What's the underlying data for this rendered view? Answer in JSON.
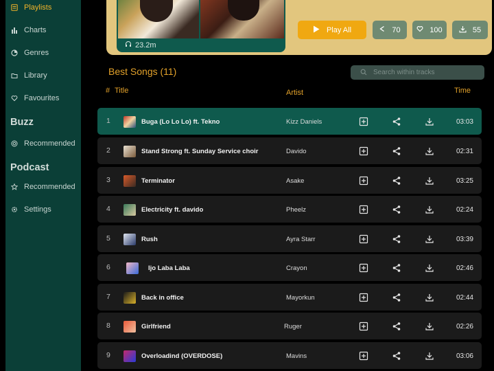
{
  "sidebar": {
    "items": [
      {
        "label": "Playlists",
        "icon": "playlist-icon",
        "active": true
      },
      {
        "label": "Charts",
        "icon": "bar-chart-icon"
      },
      {
        "label": "Genres",
        "icon": "pie-chart-icon"
      },
      {
        "label": "Library",
        "icon": "folder-icon"
      },
      {
        "label": "Favourites",
        "icon": "heart-icon"
      }
    ],
    "buzz": {
      "title": "Buzz",
      "items": [
        {
          "label": "Recommended",
          "icon": "target-icon"
        }
      ]
    },
    "podcast": {
      "title": "Podcast",
      "items": [
        {
          "label": "Recommended",
          "icon": "star-icon"
        }
      ]
    },
    "settings": {
      "label": "Settings",
      "icon": "gear-icon"
    }
  },
  "hero": {
    "listens": "23.2m",
    "play_label": "Play All",
    "shares": "70",
    "likes": "100",
    "downloads": "55"
  },
  "section": {
    "title": "Best Songs (11)",
    "search_placeholder": "Search within tracks"
  },
  "columns": {
    "hash": "#",
    "title": "Title",
    "artist": "Artist",
    "time": "Time"
  },
  "colors": {
    "accent": "#f0a811",
    "sidebar": "#0b3f37",
    "active_row": "#0f5a4d",
    "hero_bg": "#e2c67e"
  },
  "tracks": [
    {
      "num": "1",
      "title": "Buga (Lo Lo Lo) ft. Tekno",
      "artist": "Kizz Daniels",
      "time": "03:03",
      "active": true
    },
    {
      "num": "2",
      "title": "Stand Strong ft. Sunday Service choir",
      "artist": "Davido",
      "time": "02:31"
    },
    {
      "num": "3",
      "title": "Terminator",
      "artist": "Asake",
      "time": "03:25"
    },
    {
      "num": "4",
      "title": "Electricity ft. davido",
      "artist": "Pheelz",
      "time": "02:24"
    },
    {
      "num": "5",
      "title": "Rush",
      "artist": "Ayra Starr",
      "time": "03:39"
    },
    {
      "num": "6",
      "title": "Ijo Laba Laba",
      "artist": "Crayon",
      "time": "02:46"
    },
    {
      "num": "7",
      "title": "Back in office",
      "artist": "Mayorkun",
      "time": "02:44"
    },
    {
      "num": "8",
      "title": "Girlfriend",
      "artist": "Ruger",
      "time": "02:26"
    },
    {
      "num": "9",
      "title": "Overloadind (OVERDOSE)",
      "artist": "Mavins",
      "time": "03:06"
    }
  ]
}
